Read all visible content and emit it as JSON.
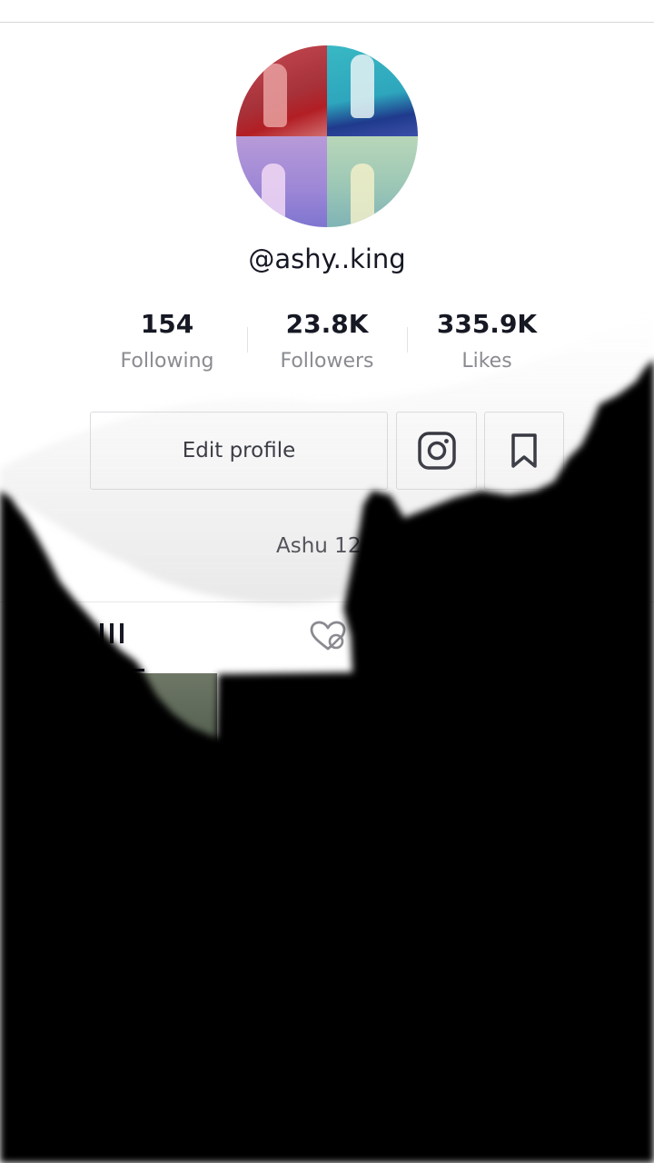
{
  "profile": {
    "username": "@ashy..king",
    "bio": "Ashu 12"
  },
  "stats": {
    "following": {
      "value": "154",
      "label": "Following"
    },
    "followers": {
      "value": "23.8K",
      "label": "Followers"
    },
    "likes": {
      "value": "335.9K",
      "label": "Likes"
    }
  },
  "actions": {
    "edit_profile_label": "Edit profile"
  },
  "icons": {
    "instagram": "instagram-icon",
    "bookmark": "bookmark-icon",
    "videos_tab": "grid-icon",
    "liked_tab": "liked-videos-hidden-icon"
  },
  "colors": {
    "text_primary": "#161823",
    "text_secondary": "#8a8b91",
    "border": "#dcdcdf"
  }
}
